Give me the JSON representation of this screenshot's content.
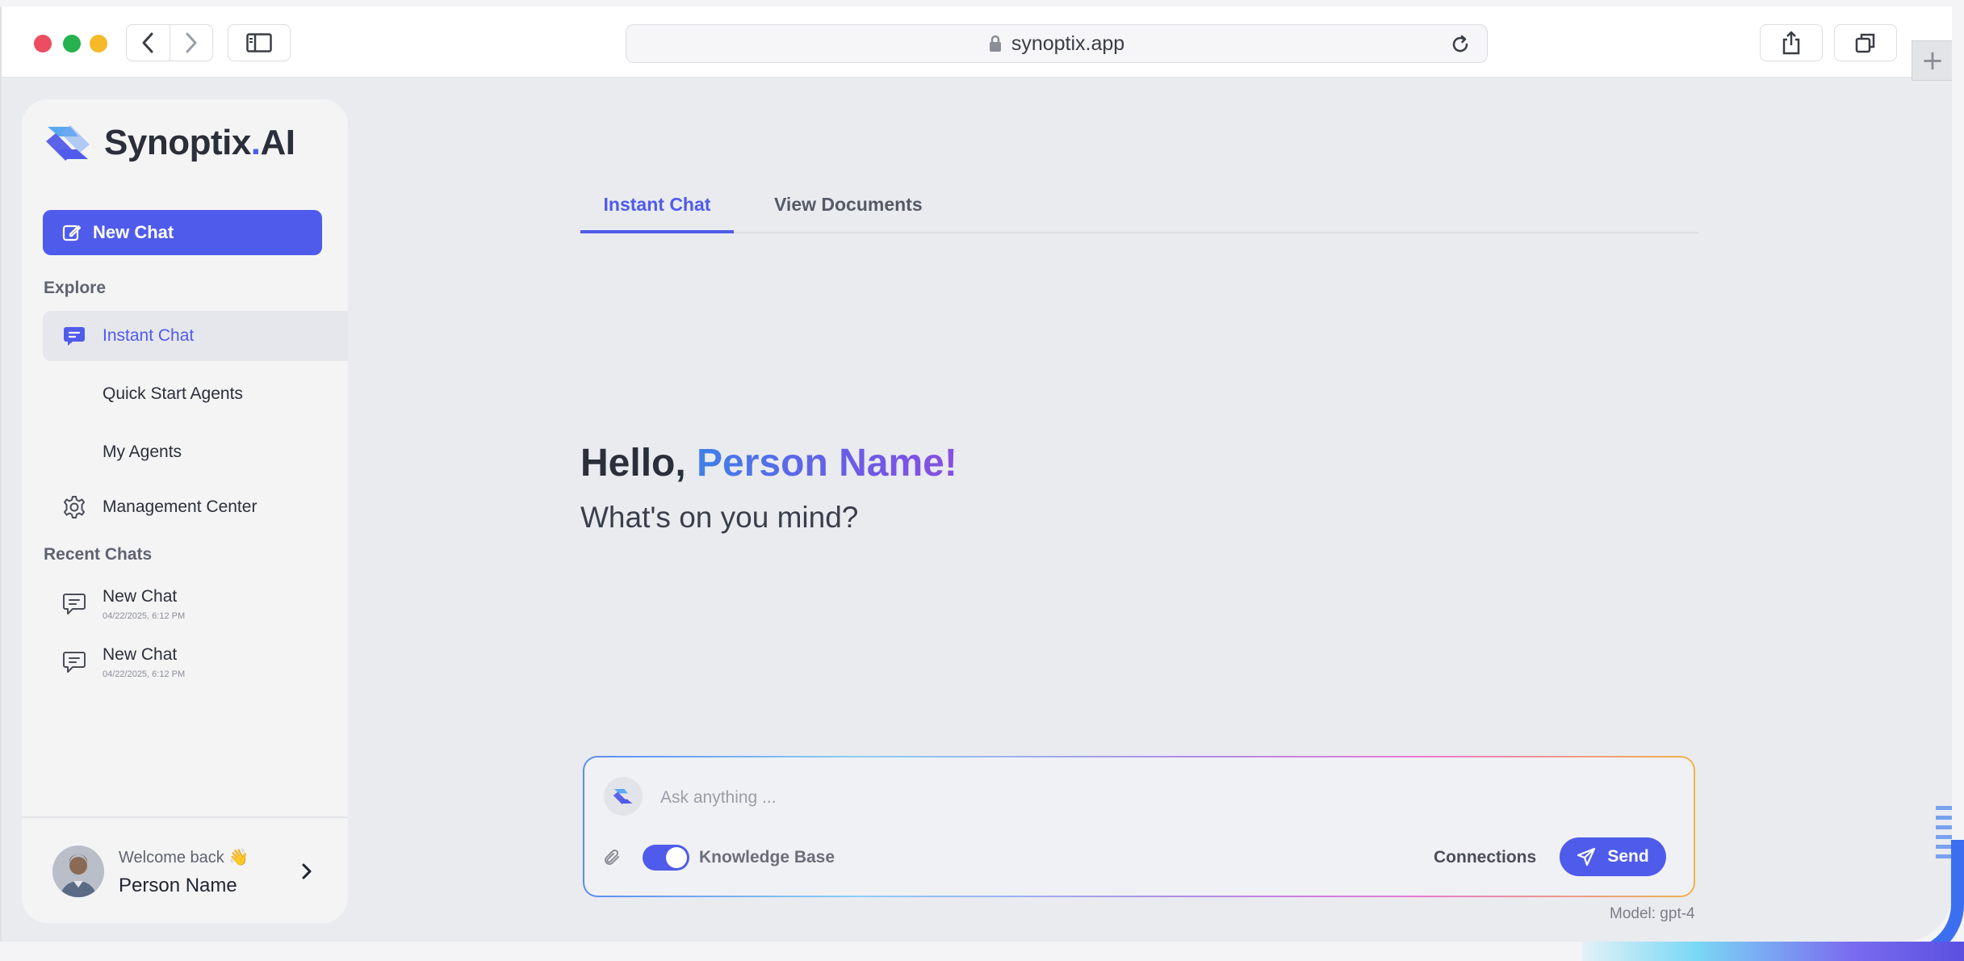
{
  "browser": {
    "url": "synoptix.app"
  },
  "sidebar": {
    "logo_name": "Synoptix",
    "logo_dot": ".",
    "logo_suffix": "AI",
    "new_chat_label": "New Chat",
    "explore_label": "Explore",
    "nav_items": [
      {
        "label": "Instant Chat",
        "icon": "chat-bubble-icon",
        "active": true
      },
      {
        "label": "Quick Start Agents",
        "icon": "",
        "active": false
      },
      {
        "label": "My Agents",
        "icon": "",
        "active": false
      },
      {
        "label": "Management Center",
        "icon": "gear-icon",
        "active": false
      }
    ],
    "recent_label": "Recent Chats",
    "recent_chats": [
      {
        "title": "New Chat",
        "date": "04/22/2025, 6:12 PM"
      },
      {
        "title": "New Chat",
        "date": "04/22/2025, 6:12 PM"
      }
    ],
    "footer": {
      "welcome": "Welcome back 👋",
      "user_name": "Person Name"
    }
  },
  "main": {
    "tabs": [
      {
        "label": "Instant Chat",
        "active": true
      },
      {
        "label": "View Documents",
        "active": false
      }
    ],
    "greeting_prefix": "Hello, ",
    "greeting_name": "Person Name!",
    "subtitle": "What's on you mind?",
    "composer": {
      "placeholder": "Ask anything ...",
      "knowledge_base_label": "Knowledge Base",
      "knowledge_base_enabled": true,
      "connections_label": "Connections",
      "send_label": "Send"
    },
    "model_label": "Model: gpt-4"
  },
  "colors": {
    "accent": "#4f5bea",
    "background": "#e9ebef",
    "sidebar": "#f4f4f5"
  }
}
